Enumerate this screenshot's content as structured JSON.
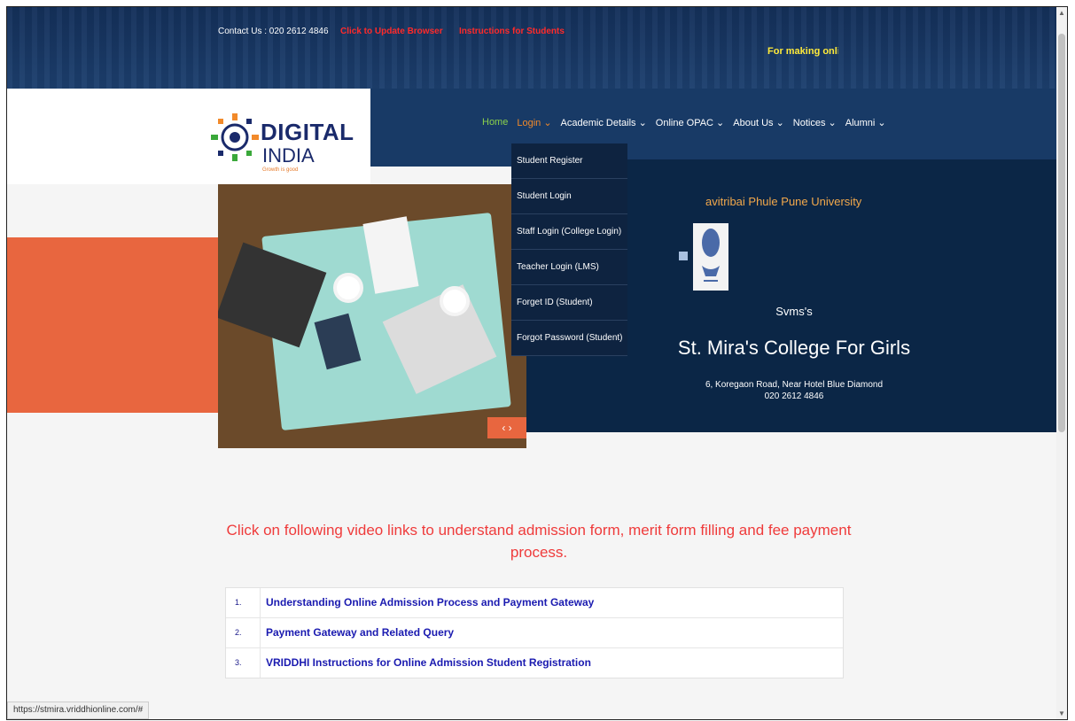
{
  "topbar": {
    "contact": "Contact Us : 020 2612 4846",
    "update_browser": "Click to Update Browser",
    "instructions": "Instructions for Students",
    "marquee": "For making online pa"
  },
  "logo": {
    "line1": "DIGITAL",
    "line2": "INDIA",
    "tagline": "Growth is good"
  },
  "nav": {
    "items": [
      {
        "label": "Home"
      },
      {
        "label": "Login ⌄"
      },
      {
        "label": "Academic Details ⌄"
      },
      {
        "label": "Online OPAC ⌄"
      },
      {
        "label": "About Us ⌄"
      },
      {
        "label": "Notices ⌄"
      },
      {
        "label": "Alumni ⌄"
      }
    ]
  },
  "login_menu": {
    "items": [
      {
        "label": "Student Register"
      },
      {
        "label": "Student Login"
      },
      {
        "label": "Staff Login (College Login)"
      },
      {
        "label": "Teacher Login (LMS)"
      },
      {
        "label": "Forget ID (Student)"
      },
      {
        "label": "Forgot Password (Student)"
      }
    ]
  },
  "hero": {
    "university": "avitribai Phule Pune University",
    "svms": "Svms's",
    "college": "St. Mira's College For Girls",
    "address": "6, Koregaon Road, Near Hotel Blue Diamond",
    "phone": "020 2612 4846"
  },
  "slider": {
    "controls": "‹   ›"
  },
  "instructions_heading": "Click on following video links to understand admission form, merit form filling and fee payment process.",
  "video_links": [
    {
      "num": "1.",
      "text": "Understanding Online Admission Process and Payment Gateway"
    },
    {
      "num": "2.",
      "text": "Payment Gateway and Related Query"
    },
    {
      "num": "3.",
      "text": "VRIDDHI Instructions for Online Admission Student Registration"
    }
  ],
  "status_url": "https://stmira.vriddhionline.com/#",
  "colors": {
    "nav_active": "#8bd14b",
    "accent_orange": "#e8663f",
    "link_red": "#ff2a2a",
    "link_blue": "#1a1ab0"
  }
}
